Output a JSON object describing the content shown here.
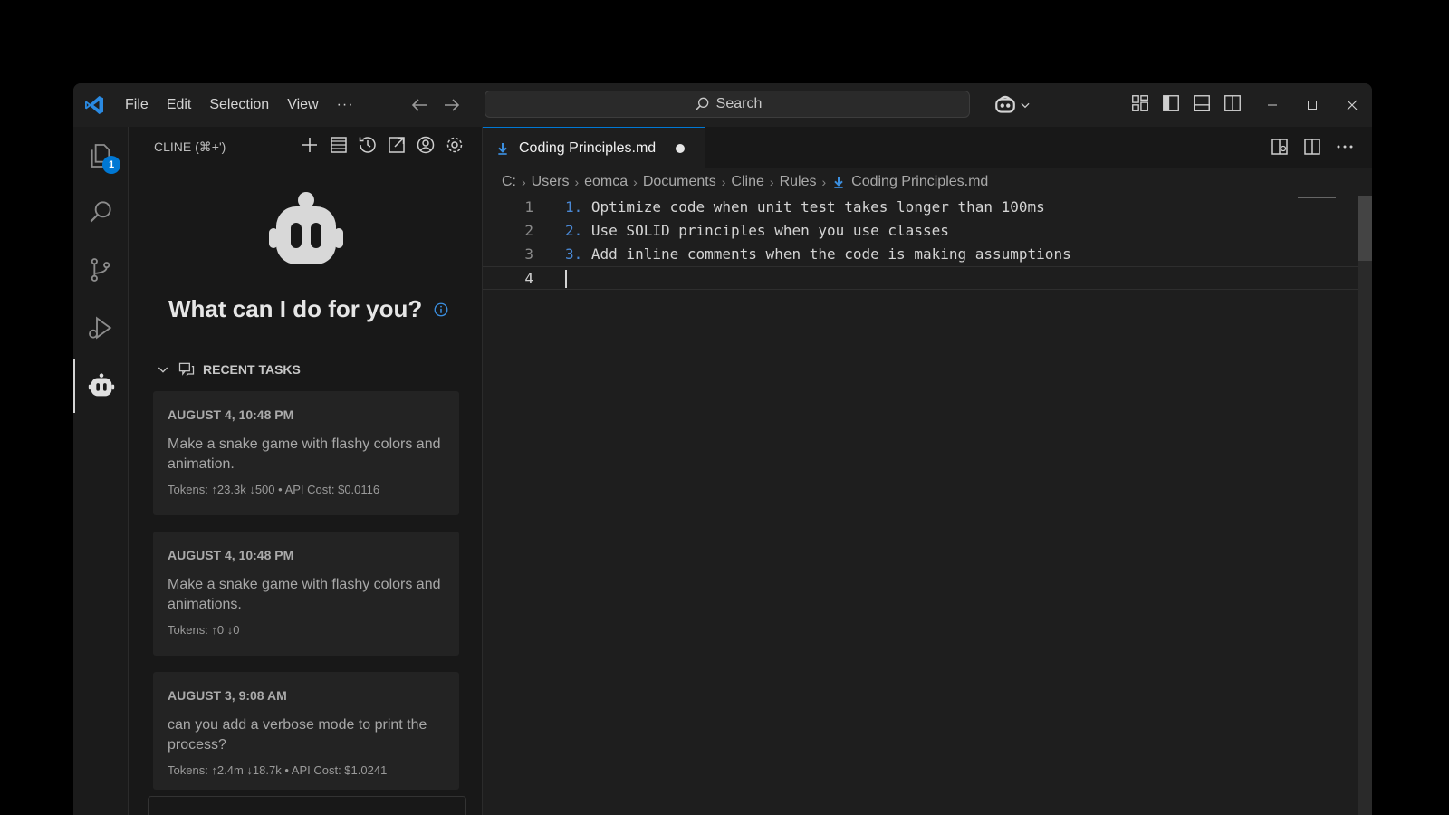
{
  "titlebar": {
    "menu": [
      "File",
      "Edit",
      "Selection",
      "View",
      "···"
    ],
    "search_label": "Search"
  },
  "activity": {
    "explorer_badge": "1"
  },
  "sidebar": {
    "title": "CLINE (⌘+')",
    "hero_title": "What can I do for you?",
    "recent_label": "RECENT TASKS",
    "tasks": [
      {
        "date": "AUGUST 4, 10:48 PM",
        "text": "Make a snake game with flashy colors and animation.",
        "meta": "Tokens: ↑23.3k ↓500 • API Cost: $0.0116"
      },
      {
        "date": "AUGUST 4, 10:48 PM",
        "text": "Make a snake game with flashy colors and animations.",
        "meta": "Tokens: ↑0 ↓0"
      },
      {
        "date": "AUGUST 3, 9:08 AM",
        "text": "can you add a verbose mode to print the process?",
        "meta": "Tokens: ↑2.4m ↓18.7k • API Cost: $1.0241"
      }
    ]
  },
  "editor": {
    "tab_label": "Coding Principles.md",
    "breadcrumb": [
      "C:",
      "Users",
      "eomca",
      "Documents",
      "Cline",
      "Rules",
      "Coding Principles.md"
    ],
    "lines": [
      {
        "num": "1",
        "marker": "1.",
        "text": " Optimize code when unit test takes longer than 100ms"
      },
      {
        "num": "2",
        "marker": "2.",
        "text": " Use SOLID principles when you use classes"
      },
      {
        "num": "3",
        "marker": "3.",
        "text": " Add inline comments when the code is making assumptions"
      },
      {
        "num": "4",
        "marker": "",
        "text": ""
      }
    ]
  },
  "colors": {
    "accent": "#0078d4",
    "markdown_marker": "#4a88d4",
    "vscode_logo": "#2a8ae2"
  }
}
